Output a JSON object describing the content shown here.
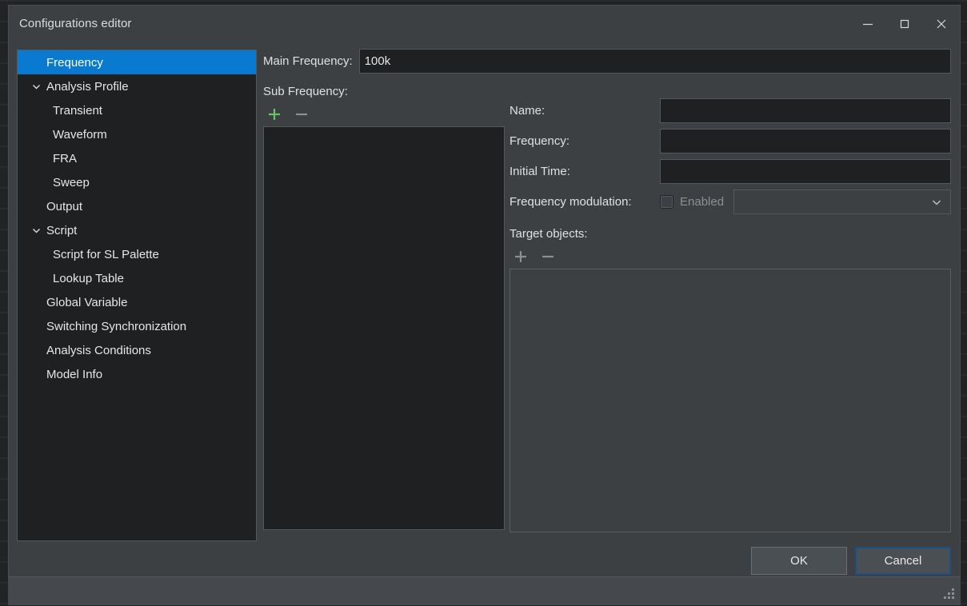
{
  "window": {
    "title": "Configurations editor",
    "controls": {
      "minimize": "minimize-icon",
      "maximize": "maximize-icon",
      "close": "close-icon"
    }
  },
  "colors": {
    "dialog_bg": "#3c4043",
    "panel_bg": "#1e2022",
    "selection_blue": "#0a7ad0",
    "focus_border": "#1b4f86",
    "add_icon_green": "#6cc16c",
    "remove_icon_gray": "#8a8f93",
    "text": "#e6e6e6",
    "disabled_text": "#8b9094"
  },
  "sidebar": {
    "items": [
      {
        "label": "Frequency",
        "level": 0,
        "selected": true,
        "twisty": "none"
      },
      {
        "label": "Analysis Profile",
        "level": 0,
        "selected": false,
        "twisty": "expanded"
      },
      {
        "label": "Transient",
        "level": 1,
        "selected": false,
        "twisty": "none"
      },
      {
        "label": "Waveform",
        "level": 1,
        "selected": false,
        "twisty": "none"
      },
      {
        "label": "FRA",
        "level": 1,
        "selected": false,
        "twisty": "none"
      },
      {
        "label": "Sweep",
        "level": 1,
        "selected": false,
        "twisty": "none"
      },
      {
        "label": "Output",
        "level": 0,
        "selected": false,
        "twisty": "none"
      },
      {
        "label": "Script",
        "level": 0,
        "selected": false,
        "twisty": "expanded"
      },
      {
        "label": "Script for SL Palette",
        "level": 1,
        "selected": false,
        "twisty": "none"
      },
      {
        "label": "Lookup Table",
        "level": 1,
        "selected": false,
        "twisty": "none"
      },
      {
        "label": "Global Variable",
        "level": 0,
        "selected": false,
        "twisty": "none"
      },
      {
        "label": "Switching Synchronization",
        "level": 0,
        "selected": false,
        "twisty": "none"
      },
      {
        "label": "Analysis Conditions",
        "level": 0,
        "selected": false,
        "twisty": "none"
      },
      {
        "label": "Model Info",
        "level": 0,
        "selected": false,
        "twisty": "none"
      }
    ]
  },
  "main": {
    "main_frequency": {
      "label": "Main Frequency:",
      "value": "100k",
      "placeholder": ""
    },
    "sub_frequency": {
      "label": "Sub Frequency:",
      "add_label": "+",
      "remove_label": "−",
      "items": []
    },
    "detail": {
      "name": {
        "label": "Name:",
        "value": "",
        "placeholder": ""
      },
      "frequency": {
        "label": "Frequency:",
        "value": "",
        "placeholder": ""
      },
      "initial_time": {
        "label": "Initial Time:",
        "value": "",
        "placeholder": ""
      },
      "frequency_modulation": {
        "label": "Frequency modulation:",
        "checkbox_label": "Enabled",
        "checked": false,
        "selected_option": "",
        "options": []
      },
      "target_objects": {
        "label": "Target objects:",
        "add_label": "+",
        "remove_label": "−",
        "items": []
      }
    }
  },
  "footer": {
    "ok_label": "OK",
    "cancel_label": "Cancel"
  }
}
